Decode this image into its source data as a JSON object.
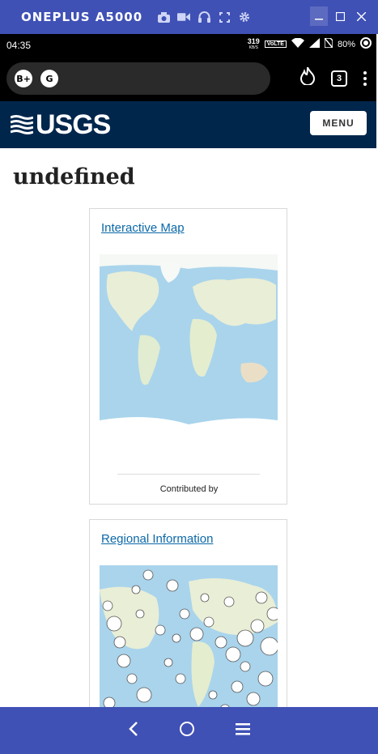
{
  "window": {
    "title": "ONEPLUS A5000"
  },
  "status_bar": {
    "time": "04:35",
    "net_speed": "319",
    "net_unit": "KB/S",
    "volte": "VoLTE",
    "battery": "80%"
  },
  "browser": {
    "tab_count": "3"
  },
  "site": {
    "logo_text": "USGS",
    "menu_label": "MENU"
  },
  "page": {
    "title": "undefined"
  },
  "cards": [
    {
      "link_label": "Interactive Map",
      "caption": "Contributed by"
    },
    {
      "link_label": "Regional Information"
    }
  ],
  "colors": {
    "window_chrome": "#3f51b5",
    "usgs_header": "#00264c",
    "link": "#0b68a8",
    "ocean": "#a9d4ec",
    "land": "#e9eed6"
  }
}
